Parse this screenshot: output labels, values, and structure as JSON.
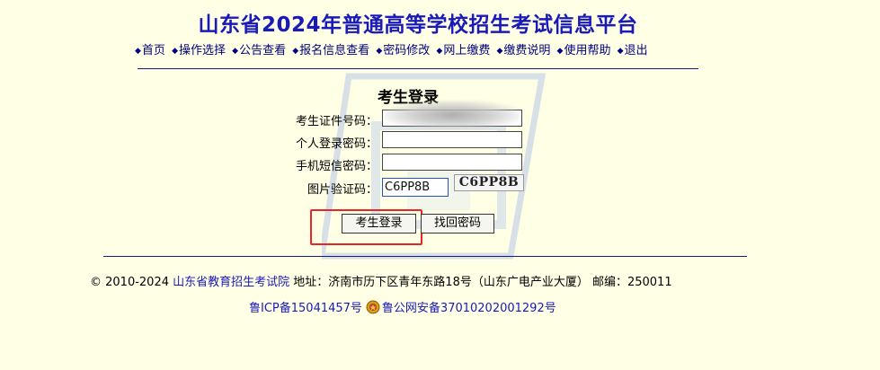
{
  "header": {
    "title": "山东省2024年普通高等学校招生考试信息平台"
  },
  "nav": {
    "bullet": "◆",
    "items": [
      "首页",
      "操作选择",
      "公告查看",
      "报名信息查看",
      "密码修改",
      "网上缴费",
      "缴费说明",
      "使用帮助",
      "退出"
    ]
  },
  "login": {
    "title": "考生登录",
    "fields": {
      "id_label": "考生证件号码：",
      "password_label": "个人登录密码：",
      "sms_label": "手机短信密码：",
      "captcha_label": "图片验证码：",
      "captcha_value": "C6PP8B",
      "captcha_image_text": "C6PP8B"
    },
    "buttons": {
      "login": "考生登录",
      "recover": "找回密码"
    }
  },
  "footer": {
    "copyright": "© 2010-2024",
    "institute": "山东省教育招生考试院",
    "address": "地址：济南市历下区青年东路18号（山东广电产业大厦） 邮编：250011",
    "icp": "鲁ICP备15041457号",
    "police": "鲁公网安备37010202001292号"
  },
  "colors": {
    "background": "#FFFFE6",
    "title": "#1A1AB8",
    "highlight": "#E8262A"
  }
}
